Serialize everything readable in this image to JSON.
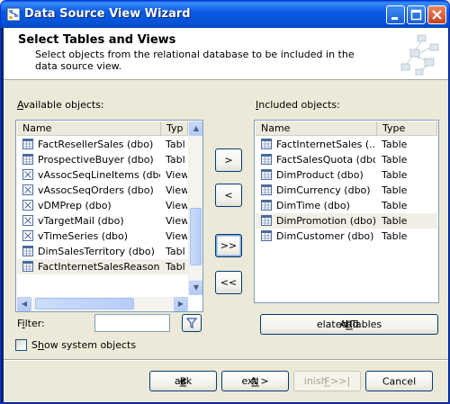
{
  "window": {
    "title": "Data Source View Wizard",
    "buttons": {
      "minimize": "minimize",
      "maximize": "maximize",
      "close": "close"
    }
  },
  "header": {
    "title": "Select Tables and Views",
    "subtitle": "Select objects from the relational database to be included in the data source view."
  },
  "available": {
    "label_prefix": "",
    "label_access": "A",
    "label_rest": "vailable objects:",
    "columns": {
      "name": "Name",
      "type": "Typ"
    },
    "rows": [
      {
        "name": "FactResellerSales (dbo)",
        "type": "Tabl",
        "icon": "table-icon"
      },
      {
        "name": "ProspectiveBuyer (dbo)",
        "type": "Tabl",
        "icon": "table-icon"
      },
      {
        "name": "vAssocSeqLineItems (dbo)",
        "type": "View",
        "icon": "view-icon"
      },
      {
        "name": "vAssocSeqOrders (dbo)",
        "type": "View",
        "icon": "view-icon"
      },
      {
        "name": "vDMPrep (dbo)",
        "type": "View",
        "icon": "view-icon"
      },
      {
        "name": "vTargetMail (dbo)",
        "type": "View",
        "icon": "view-icon"
      },
      {
        "name": "vTimeSeries (dbo)",
        "type": "View",
        "icon": "view-icon"
      },
      {
        "name": "DimSalesTerritory (dbo)",
        "type": "Tabl",
        "icon": "table-icon"
      },
      {
        "name": "FactInternetSalesReason ...",
        "type": "Tabl",
        "icon": "table-icon"
      }
    ]
  },
  "included": {
    "label_prefix": "",
    "label_access": "I",
    "label_rest": "ncluded objects:",
    "columns": {
      "name": "Name",
      "type": "Type"
    },
    "rows": [
      {
        "name": "FactInternetSales (...",
        "type": "Table",
        "icon": "table-icon"
      },
      {
        "name": "FactSalesQuota (dbo)",
        "type": "Table",
        "icon": "table-icon"
      },
      {
        "name": "DimProduct (dbo)",
        "type": "Table",
        "icon": "table-icon"
      },
      {
        "name": "DimCurrency (dbo)",
        "type": "Table",
        "icon": "table-icon"
      },
      {
        "name": "DimTime (dbo)",
        "type": "Table",
        "icon": "table-icon"
      },
      {
        "name": "DimPromotion (dbo)",
        "type": "Table",
        "icon": "table-icon"
      },
      {
        "name": "DimCustomer (dbo)",
        "type": "Table",
        "icon": "table-icon"
      }
    ]
  },
  "transfer": {
    "add": ">",
    "remove": "<",
    "add_all": ">>",
    "remove_all": "<<"
  },
  "filter": {
    "label_prefix": "F",
    "label_access": "i",
    "label_rest": "lter:",
    "value": ""
  },
  "show_system": {
    "label_prefix": "S",
    "label_access": "h",
    "label_rest": "ow system objects",
    "checked": false
  },
  "add_related": {
    "prefix": "Add ",
    "access": "R",
    "rest": "elated Tables"
  },
  "footer": {
    "back": {
      "prefix": "< ",
      "access": "B",
      "rest": "ack"
    },
    "next": {
      "prefix": "",
      "access": "N",
      "rest": "ext >"
    },
    "finish": {
      "prefix": "",
      "access": "F",
      "rest": "inish >>|"
    },
    "cancel": {
      "label": "Cancel"
    }
  }
}
